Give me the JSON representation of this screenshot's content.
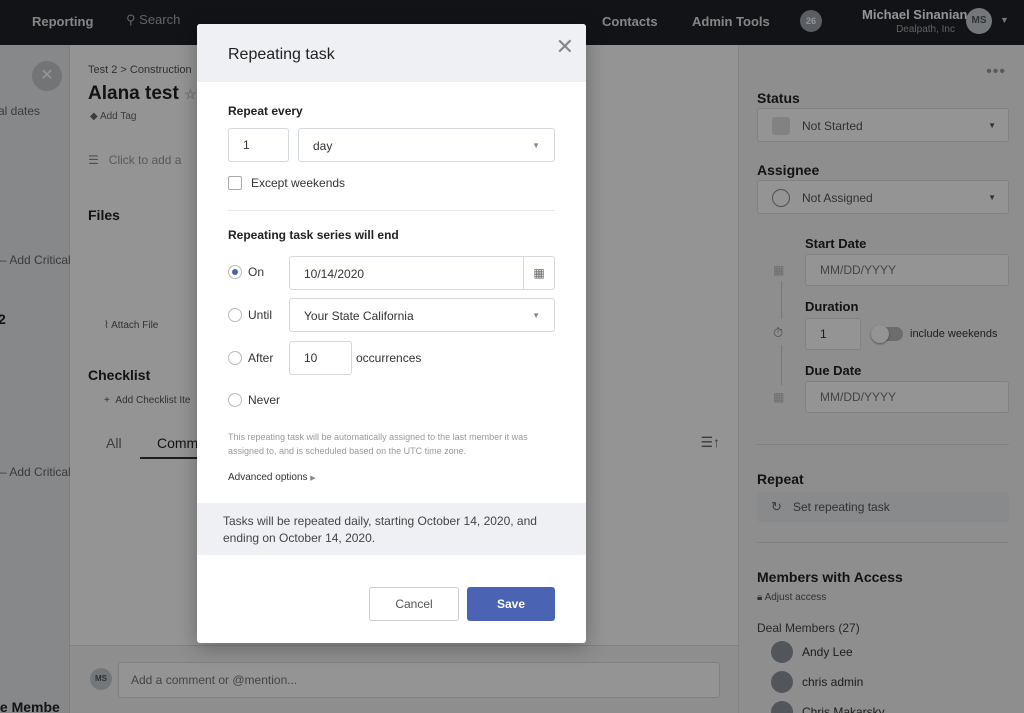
{
  "topbar": {
    "reporting": "Reporting",
    "search_placeholder": "Search",
    "contacts": "Contacts",
    "admin_tools": "Admin Tools",
    "notif_count": "26",
    "user_name": "Michael Sinanian",
    "user_company": "Dealpath, Inc",
    "user_initials": "MS"
  },
  "left_strip": {
    "dates_label": "al dates",
    "add_critical_1": "Add Critical",
    "number": "2",
    "add_critical_2": "Add Critical",
    "members_label": "le Membe"
  },
  "main": {
    "breadcrumb": "Test 2 > Construction",
    "task_title": "Alana test",
    "add_tag": "Add Tag",
    "click_to_add": "Click to add a",
    "files_heading": "Files",
    "attach_file": "Attach File",
    "checklist_heading": "Checklist",
    "add_checklist": "Add Checklist Ite",
    "tab_all": "All",
    "tab_comments": "Comm",
    "comment_initials": "MS",
    "comment_placeholder": "Add a comment or @mention..."
  },
  "right_panel": {
    "status_heading": "Status",
    "status_value": "Not Started",
    "assignee_heading": "Assignee",
    "assignee_value": "Not Assigned",
    "start_date_label": "Start Date",
    "start_date_placeholder": "MM/DD/YYYY",
    "duration_label": "Duration",
    "duration_value": "1",
    "include_weekends": "include weekends",
    "due_date_label": "Due Date",
    "due_date_placeholder": "MM/DD/YYYY",
    "repeat_heading": "Repeat",
    "set_repeating": "Set repeating task",
    "members_heading": "Members with Access",
    "adjust_access": "Adjust access",
    "deal_members": "Deal Members (27)",
    "members": [
      "Andy Lee",
      "chris admin",
      "Chris Makarsky"
    ]
  },
  "modal": {
    "title": "Repeating task",
    "repeat_every_label": "Repeat every",
    "repeat_count": "1",
    "repeat_unit": "day",
    "except_weekends": "Except weekends",
    "series_end_label": "Repeating task series will end",
    "opt_on": "On",
    "on_date": "10/14/2020",
    "opt_until": "Until",
    "until_value": "Your State California",
    "opt_after": "After",
    "after_count": "10",
    "occurrences": "occurrences",
    "opt_never": "Never",
    "note": "This repeating task will be automatically assigned to the last member it was assigned to, and is scheduled based on the UTC time zone.",
    "advanced_options": "Advanced options",
    "summary": "Tasks will be repeated daily, starting October 14, 2020, and ending on October 14, 2020.",
    "cancel": "Cancel",
    "save": "Save"
  },
  "colors": {
    "primary": "#4a63b3",
    "topbar": "#1e2126"
  }
}
